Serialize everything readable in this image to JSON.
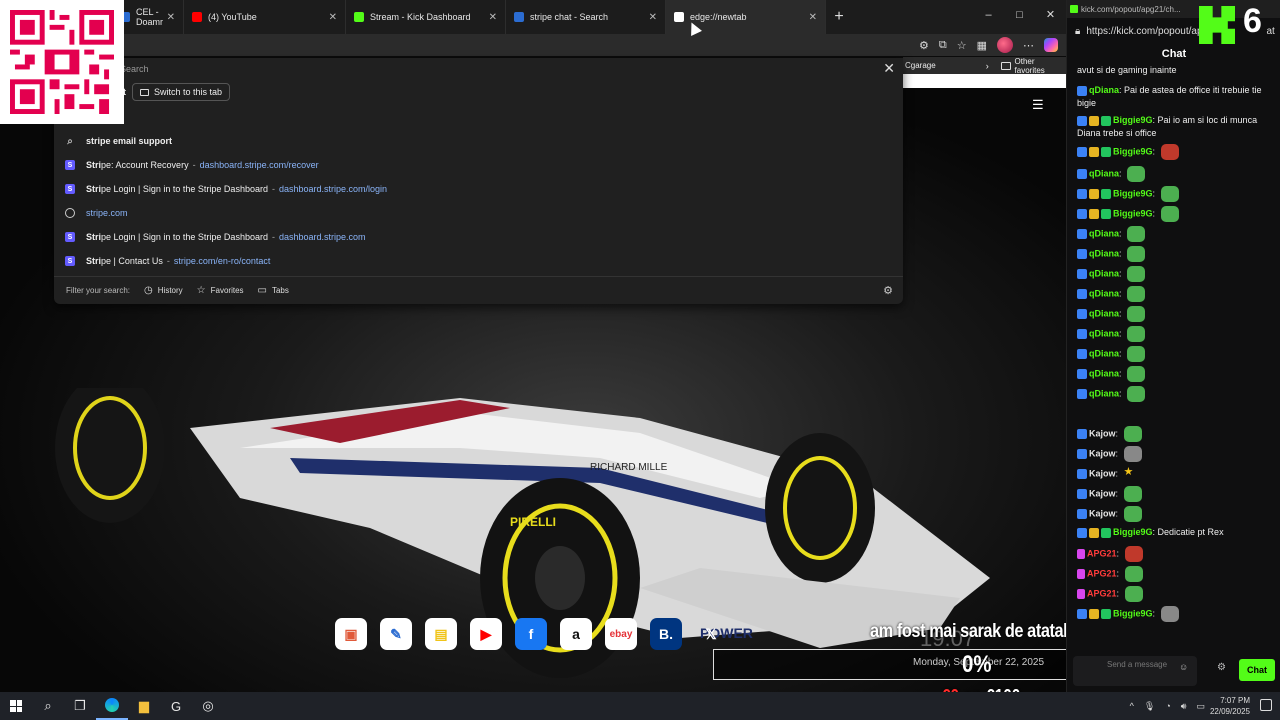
{
  "browser": {
    "tabs": [
      {
        "title": "CEL - Doamr",
        "icon": "cel-icon",
        "color": "#2b6cd1"
      },
      {
        "title": "(4) YouTube",
        "icon": "youtube-icon",
        "color": "#ff0000"
      },
      {
        "title": "Stream - Kick Dashboard",
        "icon": "kick-icon",
        "color": "#53fc18"
      },
      {
        "title": "stripe chat - Search",
        "icon": "search-icon",
        "color": "#2b6cd1"
      },
      {
        "title": "edge://newtab",
        "icon": "page-icon",
        "color": "#ffffff"
      }
    ],
    "window_controls": {
      "minimize": "–",
      "maximize": "□",
      "close": "✕"
    },
    "favorites": {
      "item": "Cgarage",
      "other": "Other favorites"
    }
  },
  "omnibox": {
    "placeholder": "Search",
    "row1_label": "at",
    "switch_tab": "Switch to this tab",
    "suggestions": [
      {
        "icon": "search",
        "bold": "stri",
        "rest_bold": "pe email support",
        "sep": "",
        "url": ""
      },
      {
        "icon": "stripe",
        "bold": "Stri",
        "rest": "pe: Account Recovery",
        "sep": "-",
        "url": "dashboard.stripe.com/recover"
      },
      {
        "icon": "stripe",
        "bold": "Stri",
        "rest": "pe Login | Sign in to the Stripe Dashboard",
        "sep": "-",
        "url": "dashboard.stripe.com/login"
      },
      {
        "icon": "globe",
        "bold": "",
        "rest": "",
        "sep": "",
        "url": "stripe.com"
      },
      {
        "icon": "stripe",
        "bold": "Stri",
        "rest": "pe Login | Sign in to the Stripe Dashboard",
        "sep": "-",
        "url": "dashboard.stripe.com"
      },
      {
        "icon": "stripe",
        "bold": "Stri",
        "rest": "pe | Contact Us",
        "sep": "-",
        "url": "stripe.com/en-ro/contact"
      }
    ],
    "footer": {
      "filter": "Filter your search:",
      "history": "History",
      "favorites": "Favorites",
      "tabs": "Tabs"
    }
  },
  "dock": [
    {
      "name": "images",
      "glyph": "▣",
      "bg": "#ffffff",
      "fg": "#e05a3a"
    },
    {
      "name": "edit",
      "glyph": "✎",
      "bg": "#ffffff",
      "fg": "#2b6cd1"
    },
    {
      "name": "notes",
      "glyph": "▤",
      "bg": "#ffffff",
      "fg": "#f0c419"
    },
    {
      "name": "youtube",
      "glyph": "▶",
      "bg": "#ffffff",
      "fg": "#ff0000"
    },
    {
      "name": "facebook",
      "glyph": "f",
      "bg": "#1877f2",
      "fg": "#ffffff"
    },
    {
      "name": "amazon",
      "glyph": "a",
      "bg": "#ffffff",
      "fg": "#111111"
    },
    {
      "name": "ebay",
      "glyph": "ebay",
      "bg": "#ffffff",
      "fg": "#e53238"
    },
    {
      "name": "booking",
      "glyph": "B.",
      "bg": "#003580",
      "fg": "#ffffff"
    },
    {
      "name": "x",
      "glyph": "𝕏",
      "bg": "transparent",
      "fg": "#ffffff"
    }
  ],
  "overlay": {
    "clock_time": "19:07",
    "clock_date": "Monday, September 22, 2025",
    "donation_text": "am fost mai sarak de atatah",
    "percent": "0%",
    "goal_current": "€0",
    "goal_on": "on",
    "goal_target": "€100"
  },
  "chat": {
    "window_title": "kick.com/popout/apg21/ch...",
    "url": "https://kick.com/popout/ap",
    "url_tail": "at",
    "header": "Chat",
    "viewer_count": "6",
    "input_placeholder": "Send a message",
    "send_label": "Chat",
    "messages": [
      {
        "badges": [],
        "user": "",
        "text": "avut si de gaming inainte",
        "emote": ""
      },
      {
        "badges": [
          "b-blue"
        ],
        "user": "qDiana",
        "uclass": "u-green",
        "text": "Pai de astea de office iti trebuie tie bigie",
        "emote": ""
      },
      {
        "badges": [
          "b-blue",
          "b-gold",
          "b-green"
        ],
        "user": "Biggie9G",
        "uclass": "u-green",
        "text": "Pai io am si loc di munca Diana trebe si office",
        "emote": ""
      },
      {
        "badges": [
          "b-blue",
          "b-gold",
          "b-green"
        ],
        "user": "Biggie9G",
        "uclass": "u-green",
        "text": "",
        "emote": "red"
      },
      {
        "badges": [
          "b-blue"
        ],
        "user": "qDiana",
        "uclass": "u-green",
        "text": "",
        "emote": "green"
      },
      {
        "badges": [
          "b-blue",
          "b-gold",
          "b-green"
        ],
        "user": "Biggie9G",
        "uclass": "u-green",
        "text": "",
        "emote": "green"
      },
      {
        "badges": [
          "b-blue",
          "b-gold",
          "b-green"
        ],
        "user": "Biggie9G",
        "uclass": "u-green",
        "text": "",
        "emote": "green"
      },
      {
        "badges": [
          "b-blue"
        ],
        "user": "qDiana",
        "uclass": "u-green",
        "text": "",
        "emote": "green"
      },
      {
        "badges": [
          "b-blue"
        ],
        "user": "qDiana",
        "uclass": "u-green",
        "text": "",
        "emote": "green"
      },
      {
        "badges": [
          "b-blue"
        ],
        "user": "qDiana",
        "uclass": "u-green",
        "text": "",
        "emote": "green"
      },
      {
        "badges": [
          "b-blue"
        ],
        "user": "qDiana",
        "uclass": "u-green",
        "text": "",
        "emote": "green"
      },
      {
        "badges": [
          "b-blue"
        ],
        "user": "qDiana",
        "uclass": "u-green",
        "text": "",
        "emote": "green"
      },
      {
        "badges": [
          "b-blue"
        ],
        "user": "qDiana",
        "uclass": "u-green",
        "text": "",
        "emote": "green"
      },
      {
        "badges": [
          "b-blue"
        ],
        "user": "qDiana",
        "uclass": "u-green",
        "text": "",
        "emote": "green"
      },
      {
        "badges": [
          "b-blue"
        ],
        "user": "qDiana",
        "uclass": "u-green",
        "text": "",
        "emote": "green"
      },
      {
        "badges": [
          "b-blue"
        ],
        "user": "qDiana",
        "uclass": "u-green",
        "text": "",
        "emote": "green"
      },
      {
        "badges": [
          "b-blue"
        ],
        "user": "Kajow",
        "uclass": "u-white",
        "text": "",
        "emote": "green"
      },
      {
        "badges": [
          "b-blue"
        ],
        "user": "Kajow",
        "uclass": "u-white",
        "text": "",
        "emote": "gray"
      },
      {
        "badges": [
          "b-blue"
        ],
        "user": "Kajow",
        "uclass": "u-white",
        "text": "",
        "emote": "star"
      },
      {
        "badges": [
          "b-blue"
        ],
        "user": "Kajow",
        "uclass": "u-white",
        "text": "",
        "emote": "green"
      },
      {
        "badges": [
          "b-blue"
        ],
        "user": "Kajow",
        "uclass": "u-white",
        "text": "",
        "emote": "green"
      },
      {
        "badges": [
          "b-blue",
          "b-gold",
          "b-green"
        ],
        "user": "Biggie9G",
        "uclass": "u-green",
        "text": "Dedicatie pt Rex",
        "emote": ""
      },
      {
        "badges": [
          "b-mic"
        ],
        "user": "APG21",
        "uclass": "u-red",
        "text": "",
        "emote": "red"
      },
      {
        "badges": [
          "b-mic"
        ],
        "user": "APG21",
        "uclass": "u-red",
        "text": "",
        "emote": "green"
      },
      {
        "badges": [
          "b-mic"
        ],
        "user": "APG21",
        "uclass": "u-red",
        "text": "",
        "emote": "green"
      },
      {
        "badges": [
          "b-blue",
          "b-gold",
          "b-green"
        ],
        "user": "Biggie9G",
        "uclass": "u-green",
        "text": "",
        "emote": "gray"
      }
    ]
  },
  "taskbar": {
    "time": "7:07 PM",
    "date": "22/09/2025",
    "tray_up": "^"
  }
}
